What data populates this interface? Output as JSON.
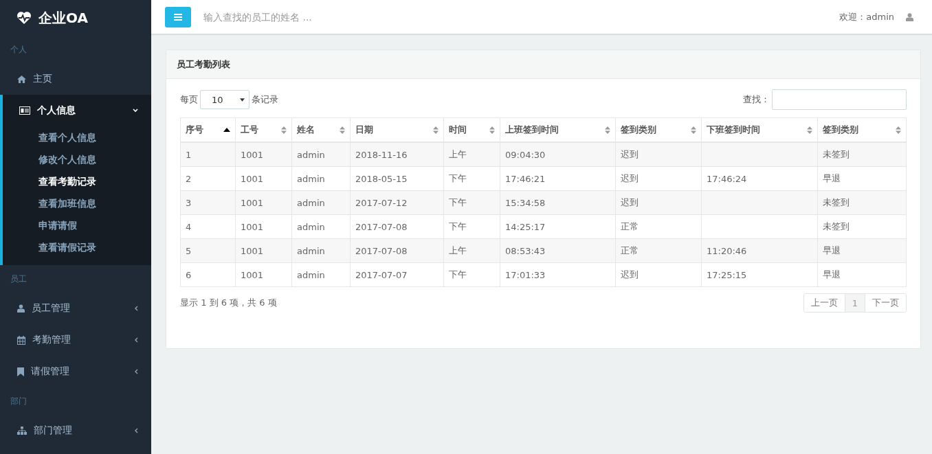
{
  "brand": {
    "title": "企业OA"
  },
  "sidebar": {
    "sections": [
      {
        "heading": "个人",
        "items": [
          {
            "kind": "link",
            "label": "主页"
          },
          {
            "kind": "menu",
            "label": "个人信息",
            "expanded": true,
            "children": [
              {
                "label": "查看个人信息",
                "selected": false
              },
              {
                "label": "修改个人信息",
                "selected": false
              },
              {
                "label": "查看考勤记录",
                "selected": true
              },
              {
                "label": "查看加班信息",
                "selected": false
              },
              {
                "label": "申请请假",
                "selected": false
              },
              {
                "label": "查看请假记录",
                "selected": false
              }
            ]
          }
        ]
      },
      {
        "heading": "员工",
        "items": [
          {
            "kind": "menu",
            "label": "员工管理",
            "expanded": false
          },
          {
            "kind": "menu",
            "label": "考勤管理",
            "expanded": false
          },
          {
            "kind": "menu",
            "label": "请假管理",
            "expanded": false
          }
        ]
      },
      {
        "heading": "部门",
        "items": [
          {
            "kind": "menu",
            "label": "部门管理",
            "expanded": false
          }
        ]
      }
    ]
  },
  "topbar": {
    "search": {
      "placeholder": "输入查找的员工的姓名 ..."
    },
    "welcome": "欢迎：admin"
  },
  "panel": {
    "title": "员工考勤列表",
    "length": {
      "prefix": "每页",
      "value": "10",
      "suffix": "条记录"
    },
    "filter": {
      "label": "查找："
    },
    "table": {
      "columns": [
        {
          "label": "序号",
          "sorted": true
        },
        {
          "label": "工号",
          "sorted": false
        },
        {
          "label": "姓名",
          "sorted": false
        },
        {
          "label": "日期",
          "sorted": false
        },
        {
          "label": "时间",
          "sorted": false
        },
        {
          "label": "上班签到时间",
          "sorted": false
        },
        {
          "label": "签到类别",
          "sorted": false
        },
        {
          "label": "下班签到时间",
          "sorted": false
        },
        {
          "label": "签到类别",
          "sorted": false
        }
      ],
      "rows": [
        [
          "1",
          "1001",
          "admin",
          "2018-11-16",
          "上午",
          "09:04:30",
          "迟到",
          "",
          "未签到"
        ],
        [
          "2",
          "1001",
          "admin",
          "2018-05-15",
          "下午",
          "17:46:21",
          "迟到",
          "17:46:24",
          "早退"
        ],
        [
          "3",
          "1001",
          "admin",
          "2017-07-12",
          "下午",
          "15:34:58",
          "迟到",
          "",
          "未签到"
        ],
        [
          "4",
          "1001",
          "admin",
          "2017-07-08",
          "下午",
          "14:25:17",
          "正常",
          "",
          "未签到"
        ],
        [
          "5",
          "1001",
          "admin",
          "2017-07-08",
          "上午",
          "08:53:43",
          "正常",
          "11:20:46",
          "早退"
        ],
        [
          "6",
          "1001",
          "admin",
          "2017-07-07",
          "下午",
          "17:01:33",
          "迟到",
          "17:25:15",
          "早退"
        ]
      ]
    },
    "info": "显示 1 到 6 项，共 6 项",
    "pagination": [
      {
        "label": "上一页",
        "selected": false
      },
      {
        "label": "1",
        "selected": true
      },
      {
        "label": "下一页",
        "selected": false
      }
    ]
  }
}
